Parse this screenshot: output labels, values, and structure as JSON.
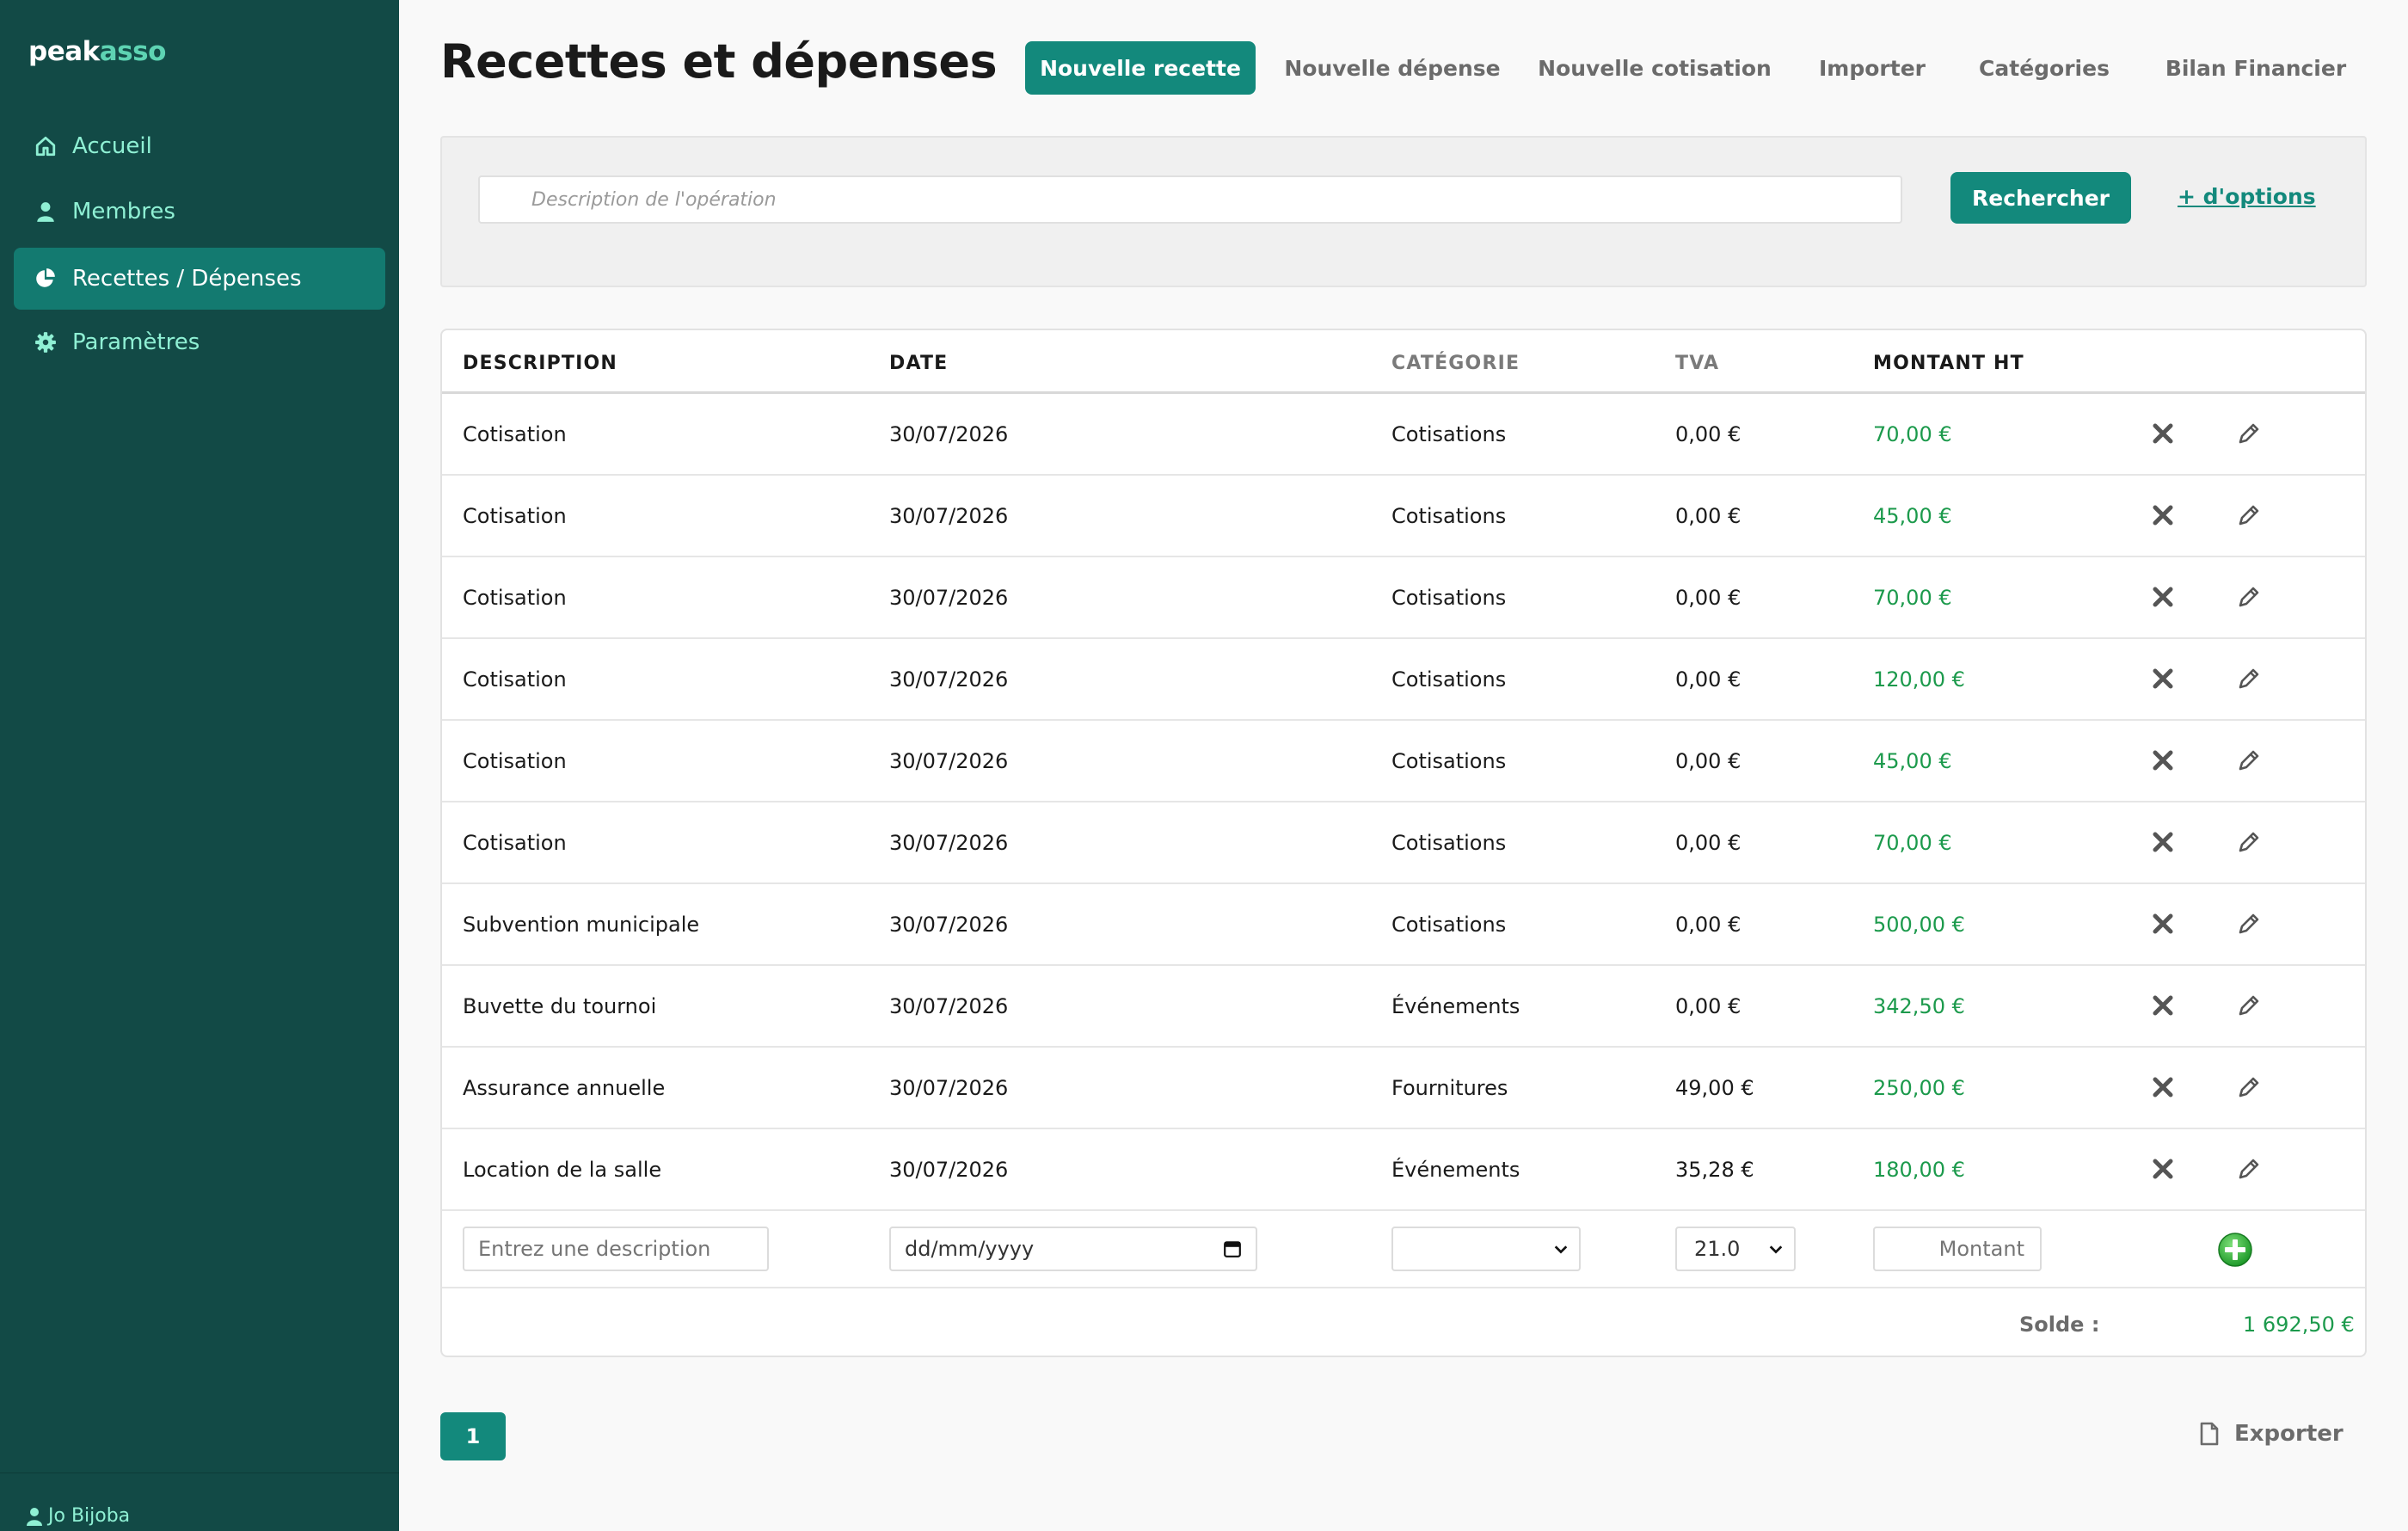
{
  "app": {
    "logo_part1": "peak",
    "logo_part2": "asso"
  },
  "sidebar": {
    "items": [
      {
        "label": "Accueil",
        "icon": "home-icon"
      },
      {
        "label": "Membres",
        "icon": "user-icon"
      },
      {
        "label": "Recettes / Dépenses",
        "icon": "pie-chart-icon",
        "active": true
      },
      {
        "label": "Paramètres",
        "icon": "gear-icon"
      }
    ],
    "user": "Jo Bijoba"
  },
  "header": {
    "title": "Recettes et dépenses",
    "buttons": {
      "new_income": "Nouvelle recette",
      "new_expense": "Nouvelle dépense",
      "new_fee": "Nouvelle cotisation",
      "import": "Importer",
      "categories": "Catégories",
      "report": "Bilan Financier"
    }
  },
  "search": {
    "placeholder": "Description de l'opération",
    "button": "Rechercher",
    "more_options": "+ d'options"
  },
  "table": {
    "headers": {
      "description": "DESCRIPTION",
      "date": "DATE",
      "category": "CATÉGORIE",
      "vat": "TVA",
      "amount": "MONTANT HT"
    },
    "rows": [
      {
        "description": "Cotisation",
        "date": "30/07/2026",
        "category": "Cotisations",
        "vat": "0,00 €",
        "amount": "70,00 €"
      },
      {
        "description": "Cotisation",
        "date": "30/07/2026",
        "category": "Cotisations",
        "vat": "0,00 €",
        "amount": "45,00 €"
      },
      {
        "description": "Cotisation",
        "date": "30/07/2026",
        "category": "Cotisations",
        "vat": "0,00 €",
        "amount": "70,00 €"
      },
      {
        "description": "Cotisation",
        "date": "30/07/2026",
        "category": "Cotisations",
        "vat": "0,00 €",
        "amount": "120,00 €"
      },
      {
        "description": "Cotisation",
        "date": "30/07/2026",
        "category": "Cotisations",
        "vat": "0,00 €",
        "amount": "45,00 €"
      },
      {
        "description": "Cotisation",
        "date": "30/07/2026",
        "category": "Cotisations",
        "vat": "0,00 €",
        "amount": "70,00 €"
      },
      {
        "description": "Subvention municipale",
        "date": "30/07/2026",
        "category": "Cotisations",
        "vat": "0,00 €",
        "amount": "500,00 €"
      },
      {
        "description": "Buvette du tournoi",
        "date": "30/07/2026",
        "category": "Événements",
        "vat": "0,00 €",
        "amount": "342,50 €"
      },
      {
        "description": "Assurance annuelle",
        "date": "30/07/2026",
        "category": "Fournitures",
        "vat": "49,00 €",
        "amount": "250,00 €"
      },
      {
        "description": "Location de la salle",
        "date": "30/07/2026",
        "category": "Événements",
        "vat": "35,28 €",
        "amount": "180,00 €"
      }
    ],
    "new_row": {
      "description_placeholder": "Entrez une description",
      "date_placeholder": "dd/mm/yyyy",
      "category_value": "",
      "vat_value": "21.0",
      "amount_placeholder": "Montant"
    },
    "balance_label": "Solde :",
    "balance_value": "1 692,50 €"
  },
  "pagination": {
    "current_page": "1"
  },
  "export_label": "Exporter",
  "colors": {
    "sidebar_bg": "#124a46",
    "primary": "#13897c",
    "nav_text": "#8ff0d4",
    "amount_green": "#1c9a4c"
  }
}
